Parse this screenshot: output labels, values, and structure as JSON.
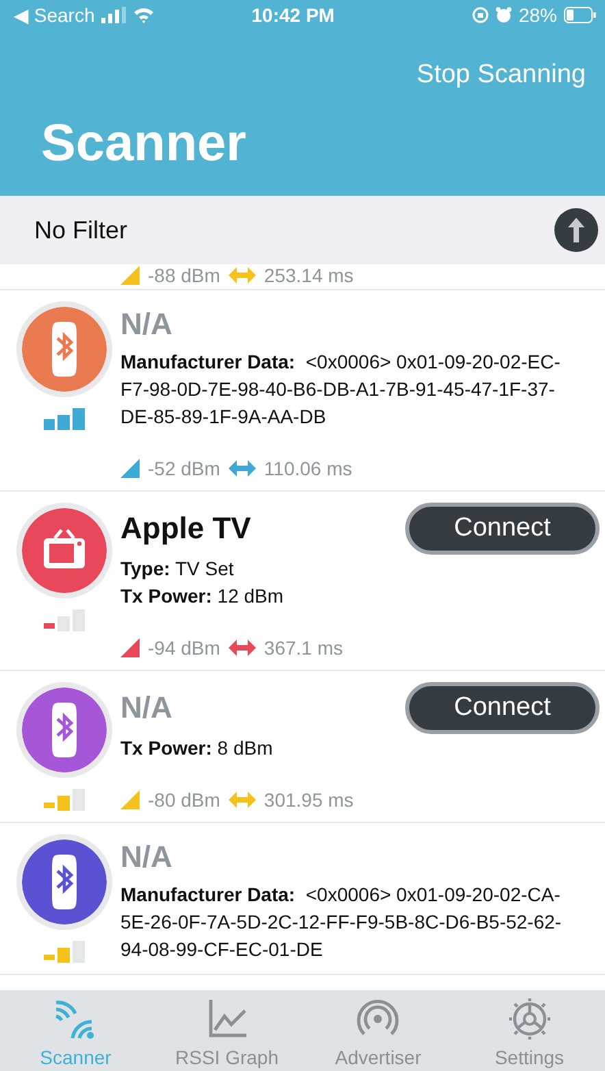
{
  "status_bar": {
    "back_glyph": "◀",
    "back_label": "Search",
    "time": "10:42 PM",
    "battery": "28%"
  },
  "header": {
    "action": "Stop Scanning",
    "title": "Scanner"
  },
  "filter": {
    "label": "No Filter"
  },
  "devices": [
    {
      "partial": true,
      "rssi": "-88 dBm",
      "interval": "253.14 ms",
      "signal": {
        "color": "#f5c21b"
      }
    },
    {
      "kind": "bluetooth",
      "color": "#ea7a4f",
      "name": "N/A",
      "known": false,
      "details": [
        {
          "label": "Manufacturer Data:",
          "value": " <0x0006> 0x01-09-20-02-EC-F7-98-0D-7E-98-40-B6-DB-A1-7B-91-45-47-1F-37-DE-85-89-1F-9A-AA-DB"
        }
      ],
      "signal": {
        "kind": "high",
        "color": "#3fa9d6"
      },
      "rssi": "-52 dBm",
      "interval": "110.06 ms"
    },
    {
      "kind": "tv",
      "color": "#e8485a",
      "name": "Apple TV",
      "known": true,
      "button": "Connect",
      "details": [
        {
          "label": "Type:",
          "value": "TV Set"
        },
        {
          "label": "Tx Power:",
          "value": "12 dBm"
        }
      ],
      "signal": {
        "kind": "low",
        "color": "#e8485a"
      },
      "rssi": "-94 dBm",
      "interval": "367.1 ms"
    },
    {
      "kind": "bluetooth",
      "color": "#a657d8",
      "name": "N/A",
      "known": false,
      "button": "Connect",
      "details": [
        {
          "label": "Tx Power:",
          "value": "8 dBm"
        }
      ],
      "signal": {
        "kind": "medium",
        "color": "#f5c21b"
      },
      "rssi": "-80 dBm",
      "interval": "301.95 ms"
    },
    {
      "kind": "bluetooth",
      "color": "#5b51d3",
      "name": "N/A",
      "known": false,
      "details": [
        {
          "label": "Manufacturer Data:",
          "value": " <0x0006> 0x01-09-20-02-CA-5E-26-0F-7A-5D-2C-12-FF-F9-5B-8C-D6-B5-52-62-94-08-99-CF-EC-01-DE"
        }
      ],
      "signal": {
        "kind": "medium",
        "color": "#f5c21b"
      }
    }
  ],
  "tabs": [
    {
      "kind": "scanner",
      "label": "Scanner",
      "selected": true
    },
    {
      "kind": "graph",
      "label": "RSSI Graph",
      "selected": false
    },
    {
      "kind": "advertiser",
      "label": "Advertiser",
      "selected": false
    },
    {
      "kind": "settings",
      "label": "Settings",
      "selected": false
    }
  ]
}
